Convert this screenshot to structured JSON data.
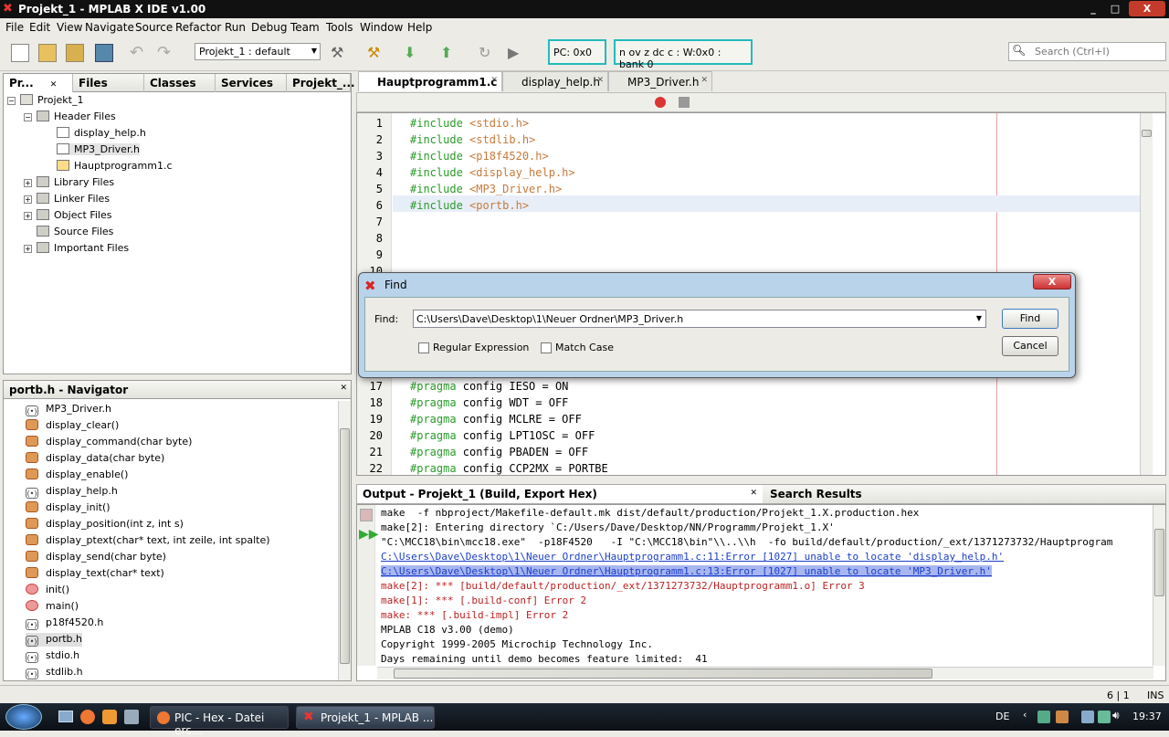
{
  "window": {
    "title": "Projekt_1 - MPLAB X IDE v1.00",
    "controls": [
      "_",
      "□",
      "X"
    ]
  },
  "menu": [
    "File",
    "Edit",
    "View",
    "Navigate",
    "Source",
    "Refactor",
    "Run",
    "Debug",
    "Team",
    "Tools",
    "Window",
    "Help"
  ],
  "toolbar": {
    "config": "Projekt_1 : default",
    "pc": "PC: 0x0",
    "status": "n ov z dc c  : W:0x0 : bank 0",
    "search_placeholder": "Search (Ctrl+I)"
  },
  "projects_panel": {
    "tabs": [
      "Pr...",
      "Files",
      "Classes",
      "Services",
      "Projekt_..."
    ],
    "tree": {
      "root": "Projekt_1",
      "header_folder": "Header Files",
      "header_files": [
        "display_help.h",
        "MP3_Driver.h",
        "Hauptprogramm1.c"
      ],
      "folders": [
        "Library Files",
        "Linker Files",
        "Object Files",
        "Source Files",
        "Important Files"
      ]
    }
  },
  "navigator": {
    "title": "portb.h - Navigator",
    "items": [
      {
        "label": "MP3_Driver.h",
        "kind": "include"
      },
      {
        "label": "display_clear()",
        "kind": "fn"
      },
      {
        "label": "display_command(char byte)",
        "kind": "fn"
      },
      {
        "label": "display_data(char byte)",
        "kind": "fn"
      },
      {
        "label": "display_enable()",
        "kind": "fn"
      },
      {
        "label": "display_help.h",
        "kind": "include"
      },
      {
        "label": "display_init()",
        "kind": "fn"
      },
      {
        "label": "display_position(int z, int s)",
        "kind": "fn"
      },
      {
        "label": "display_ptext(char* text, int zeile, int spalte)",
        "kind": "fn"
      },
      {
        "label": "display_send(char byte)",
        "kind": "fn"
      },
      {
        "label": "display_text(char* text)",
        "kind": "fn"
      },
      {
        "label": "init()",
        "kind": "fnr"
      },
      {
        "label": "main()",
        "kind": "fnr"
      },
      {
        "label": "p18f4520.h",
        "kind": "include"
      },
      {
        "label": "portb.h",
        "kind": "include",
        "selected": true
      },
      {
        "label": "stdio.h",
        "kind": "include"
      },
      {
        "label": "stdlib.h",
        "kind": "include"
      }
    ]
  },
  "editor": {
    "tabs": [
      "Hauptprogramm1.c",
      "display_help.h",
      "MP3_Driver.h"
    ],
    "lines": [
      {
        "n": "1",
        "kw": "#include",
        "rest": " <stdio.h>"
      },
      {
        "n": "2",
        "kw": "#include",
        "rest": " <stdlib.h>"
      },
      {
        "n": "3",
        "kw": "#include",
        "rest": " <p18f4520.h>"
      },
      {
        "n": "4",
        "kw": "#include",
        "rest": " <display_help.h>"
      },
      {
        "n": "5",
        "kw": "#include",
        "rest": " <MP3_Driver.h>"
      },
      {
        "n": "6",
        "kw": "#include",
        "rest": " <portb.h>"
      },
      {
        "n": "7",
        "kw": "",
        "rest": ""
      },
      {
        "n": "8",
        "kw": "",
        "rest": ""
      },
      {
        "n": "9",
        "kw": "",
        "rest": ""
      },
      {
        "n": "10",
        "kw": "",
        "rest": ""
      },
      {
        "n": "17",
        "kw": "#pragma",
        "rest": " config IESO = ON"
      },
      {
        "n": "18",
        "kw": "#pragma",
        "rest": " config WDT = OFF"
      },
      {
        "n": "19",
        "kw": "#pragma",
        "rest": " config MCLRE = OFF"
      },
      {
        "n": "20",
        "kw": "#pragma",
        "rest": " config LPT1OSC = OFF"
      },
      {
        "n": "21",
        "kw": "#pragma",
        "rest": " config PBADEN = OFF"
      },
      {
        "n": "22",
        "kw": "#pragma",
        "rest": " config CCP2MX = PORTBE"
      }
    ]
  },
  "find_dialog": {
    "title": "Find",
    "find_label": "Find:",
    "find_value": "C:\\Users\\Dave\\Desktop\\1\\Neuer Ordner\\MP3_Driver.h",
    "regex_label": "Regular Expression",
    "matchcase_label": "Match Case",
    "find_button": "Find",
    "cancel_button": "Cancel",
    "close": "X"
  },
  "output": {
    "tab": "Output - Projekt_1 (Build, Export Hex)",
    "tab2": "Search Results",
    "lines": [
      {
        "text": "make  -f nbproject/Makefile-default.mk dist/default/production/Projekt_1.X.production.hex",
        "style": "normal"
      },
      {
        "text": "make[2]: Entering directory `C:/Users/Dave/Desktop/NN/Programm/Projekt_1.X'",
        "style": "normal"
      },
      {
        "text": "\"C:\\MCC18\\bin\\mcc18.exe\"  -p18F4520   -I \"C:\\MCC18\\bin\"\\\\..\\\\h  -fo build/default/production/_ext/1371273732/Hauptprogram",
        "style": "normal"
      },
      {
        "text": "C:\\Users\\Dave\\Desktop\\1\\Neuer Ordner\\Hauptprogramm1.c:11:Error [1027] unable to locate 'display_help.h'",
        "style": "link"
      },
      {
        "text": "C:\\Users\\Dave\\Desktop\\1\\Neuer Ordner\\Hauptprogramm1.c:13:Error [1027] unable to locate 'MP3_Driver.h'",
        "style": "selected"
      },
      {
        "text": "make[2]: *** [build/default/production/_ext/1371273732/Hauptprogramm1.o] Error 3",
        "style": "error"
      },
      {
        "text": "make[1]: *** [.build-conf] Error 2",
        "style": "error"
      },
      {
        "text": "make: *** [.build-impl] Error 2",
        "style": "error"
      },
      {
        "text": "MPLAB C18 v3.00 (demo)",
        "style": "normal"
      },
      {
        "text": "Copyright 1999-2005 Microchip Technology Inc.",
        "style": "normal"
      },
      {
        "text": "Days remaining until demo becomes feature limited:  41",
        "style": "normal"
      }
    ]
  },
  "status": {
    "position": "6 | 1",
    "mode": "INS"
  },
  "taskbar": {
    "tasks": [
      "PIC - Hex - Datei ers...",
      "Projekt_1 - MPLAB ..."
    ],
    "lang": "DE",
    "clock": "19:37"
  }
}
